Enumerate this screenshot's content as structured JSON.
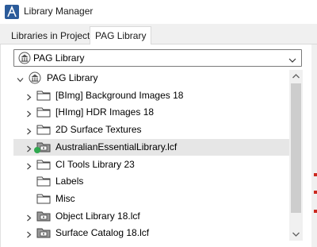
{
  "window": {
    "title": "Library Manager"
  },
  "tabs": [
    {
      "label": "Libraries in Project",
      "active": false
    },
    {
      "label": "PAG Library",
      "active": true
    }
  ],
  "dropdown": {
    "selected": "PAG Library"
  },
  "tree": {
    "items": [
      {
        "label": "PAG Library",
        "icon": "library-icon",
        "expanded": true,
        "level": 0
      },
      {
        "label": "[BImg] Background Images 18",
        "icon": "folder-icon",
        "level": 1
      },
      {
        "label": "[HImg] HDR Images 18",
        "icon": "folder-icon",
        "level": 1
      },
      {
        "label": "2D Surface Textures",
        "icon": "folder-icon",
        "level": 1
      },
      {
        "label": "AustralianEssentialLibrary.lcf",
        "icon": "container-folder-icon",
        "level": 1,
        "selected": true,
        "status": "green-dot"
      },
      {
        "label": "CI Tools Library 23",
        "icon": "folder-icon",
        "level": 1
      },
      {
        "label": "Labels",
        "icon": "folder-icon",
        "level": 1,
        "no_chevron": true
      },
      {
        "label": "Misc",
        "icon": "folder-icon",
        "level": 1,
        "no_chevron": true
      },
      {
        "label": "Object Library 18.lcf",
        "icon": "container-folder-icon",
        "level": 1
      },
      {
        "label": "Surface Catalog 18.lcf",
        "icon": "container-folder-icon",
        "level": 1
      }
    ]
  },
  "colors": {
    "selection": "#e6e6e6",
    "status_dot": "#2fa84f",
    "accent_red": "#cc2a20"
  }
}
